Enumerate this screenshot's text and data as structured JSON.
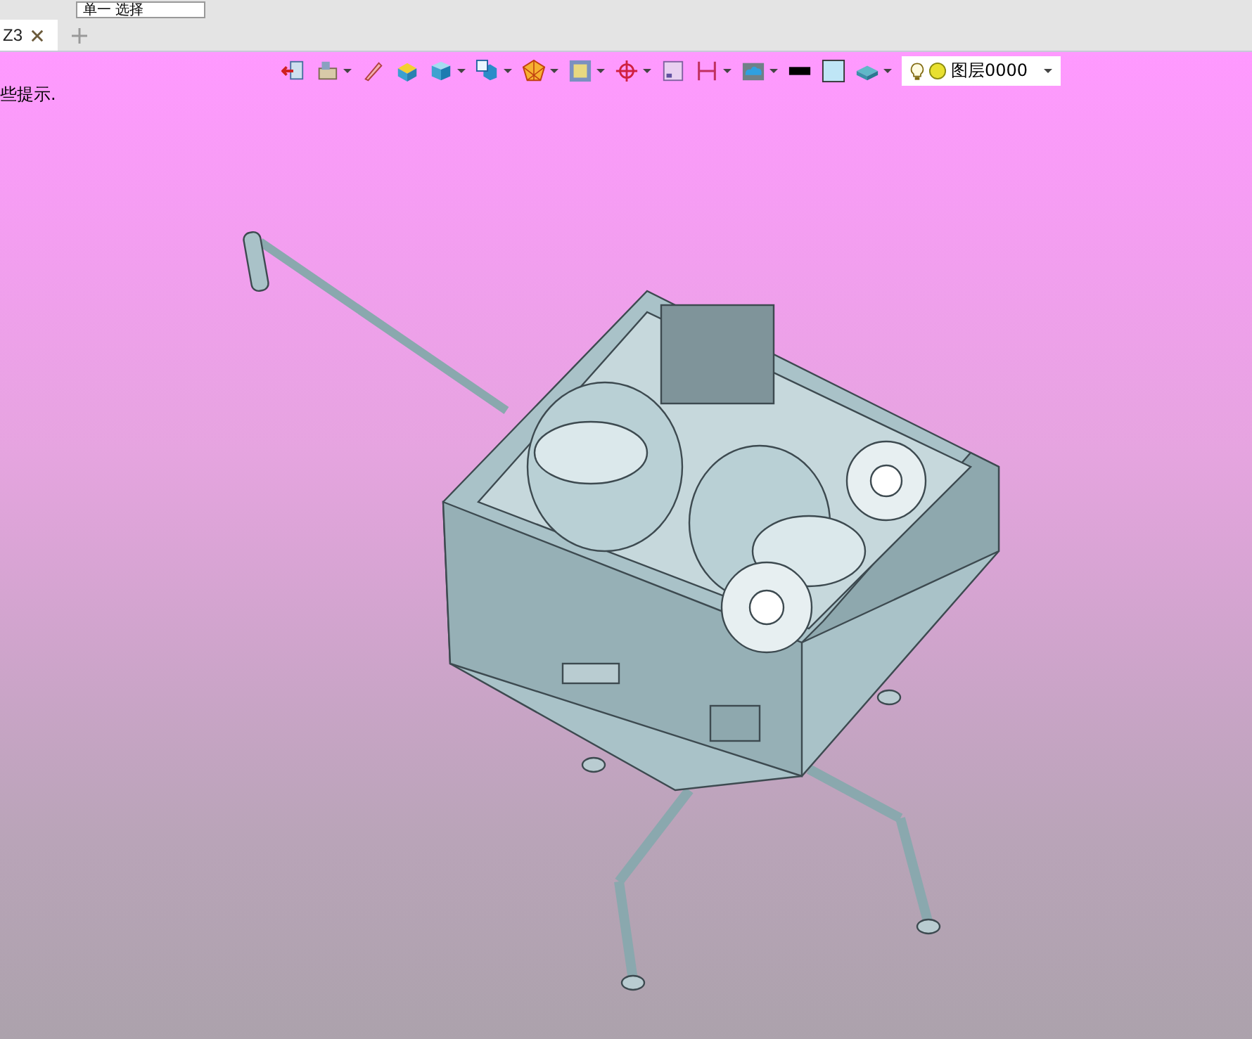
{
  "top_toolbar": {
    "selection_field": {
      "value": "单一 选择"
    }
  },
  "tabs": [
    {
      "label": "Z3",
      "selected": true
    }
  ],
  "viewport": {
    "hint": "些提示.",
    "view_toolbar": [
      {
        "kind": "exit",
        "dropdown": false
      },
      {
        "kind": "sheets",
        "dropdown": true
      },
      {
        "kind": "pencil",
        "dropdown": false
      },
      {
        "kind": "plane",
        "dropdown": false
      },
      {
        "kind": "cube",
        "dropdown": true
      },
      {
        "kind": "view",
        "dropdown": true
      },
      {
        "kind": "render",
        "dropdown": true
      },
      {
        "kind": "frame",
        "dropdown": true
      },
      {
        "kind": "target",
        "dropdown": true
      },
      {
        "kind": "square",
        "dropdown": false
      },
      {
        "kind": "measure",
        "dropdown": true
      },
      {
        "kind": "scene",
        "dropdown": true
      },
      {
        "kind": "line",
        "dropdown": false
      },
      {
        "kind": "fill",
        "dropdown": false
      },
      {
        "kind": "layer",
        "dropdown": true
      }
    ],
    "layer_selector": {
      "value": "图层0000"
    }
  }
}
